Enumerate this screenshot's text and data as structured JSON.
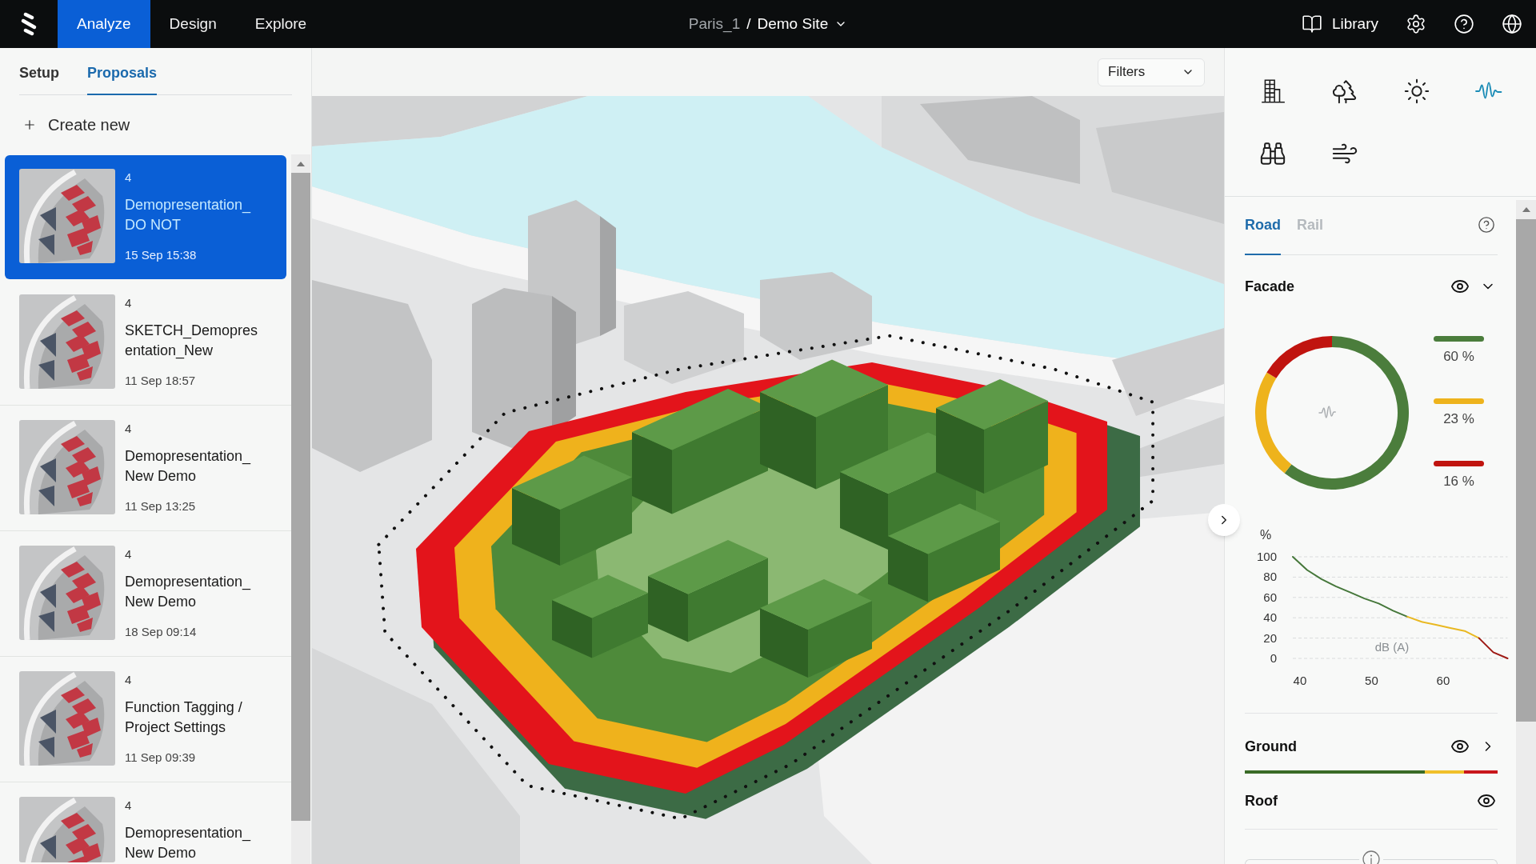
{
  "top_bar": {
    "nav_tabs": [
      {
        "label": "Analyze",
        "selected": true
      },
      {
        "label": "Design",
        "selected": false
      },
      {
        "label": "Explore",
        "selected": false
      }
    ],
    "breadcrumb": {
      "project": "Paris_1",
      "separator": "/",
      "site": "Demo Site"
    },
    "actions": [
      {
        "kind": "library",
        "label": "Library"
      },
      {
        "kind": "settings"
      },
      {
        "kind": "help"
      },
      {
        "kind": "language"
      }
    ]
  },
  "left_panel": {
    "tabs": [
      {
        "label": "Setup",
        "selected": false
      },
      {
        "label": "Proposals",
        "selected": true
      }
    ],
    "create_button": "Create new",
    "proposals": [
      {
        "count": "4",
        "title": "Demopresentation_DO NOT",
        "date": "15 Sep 15:38",
        "selected": true
      },
      {
        "count": "4",
        "title": "SKETCH_Demopresentation_New",
        "date": "11 Sep 18:57",
        "selected": false
      },
      {
        "count": "4",
        "title": "Demopresentation_New Demo",
        "date": "11 Sep 13:25",
        "selected": false
      },
      {
        "count": "4",
        "title": "Demopresentation_New Demo",
        "date": "18 Sep 09:14",
        "selected": false
      },
      {
        "count": "4",
        "title": "Function Tagging / Project Settings",
        "date": "11 Sep 09:39",
        "selected": false
      },
      {
        "count": "4",
        "title": "Demopresentation_New Demo",
        "selected": false
      }
    ]
  },
  "map": {
    "filters": {
      "label": "Filters"
    }
  },
  "right_panel": {
    "tools": [
      {
        "kind": "building",
        "selected": false
      },
      {
        "kind": "trees",
        "selected": false
      },
      {
        "kind": "sun",
        "selected": false
      },
      {
        "kind": "noise",
        "selected": true
      },
      {
        "kind": "view",
        "selected": false
      },
      {
        "kind": "wind",
        "selected": false
      }
    ],
    "tabs": [
      {
        "label": "Road",
        "selected": true
      },
      {
        "label": "Rail",
        "selected": false
      }
    ],
    "sections": [
      {
        "kind": "detail",
        "title": "Facade",
        "visible": true,
        "expanded": true,
        "legend": [
          {
            "reading": "60 %",
            "color": "#4b7d3c"
          },
          {
            "reading": "23 %",
            "color": "#eeb31c"
          },
          {
            "reading": "16 %",
            "color": "#c0140f"
          }
        ],
        "donut": {
          "chart_data": {
            "type": "donut",
            "values": [
              60,
              23,
              16
            ]
          }
        },
        "curve": {
          "chart_data": {
            "type": "line",
            "xlabel": "dB (A)",
            "ylabel": "%",
            "x": [
              39,
              41,
              43,
              45,
              47,
              49,
              51,
              53,
              55,
              57,
              59,
              61,
              63,
              65,
              67,
              69
            ],
            "series": [
              {
                "color": "#45773a",
                "values": [
                  100,
                  87,
                  78,
                  71,
                  65,
                  59,
                  54,
                  47,
                  41,
                  null,
                  null,
                  null,
                  null,
                  null,
                  null,
                  null
                ]
              },
              {
                "color": "#e9b821",
                "values": [
                  null,
                  null,
                  null,
                  null,
                  null,
                  null,
                  null,
                  null,
                  41,
                  36,
                  33,
                  30,
                  27,
                  20,
                  null,
                  null
                ]
              },
              {
                "color": "#9e1a15",
                "values": [
                  null,
                  null,
                  null,
                  null,
                  null,
                  null,
                  null,
                  null,
                  null,
                  null,
                  null,
                  null,
                  null,
                  20,
                  6,
                  0
                ]
              }
            ],
            "xlim": [
              39,
              69
            ],
            "ylim": [
              0,
              100
            ],
            "xticks": [
              40,
              50,
              60
            ],
            "yticks": [
              0,
              20,
              40,
              60,
              80,
              100
            ],
            "grid": true
          }
        }
      },
      {
        "kind": "distribution",
        "title": "Ground",
        "visible": true,
        "expanded": false
      },
      {
        "kind": "plain",
        "title": "Roof",
        "visible": true
      }
    ]
  }
}
